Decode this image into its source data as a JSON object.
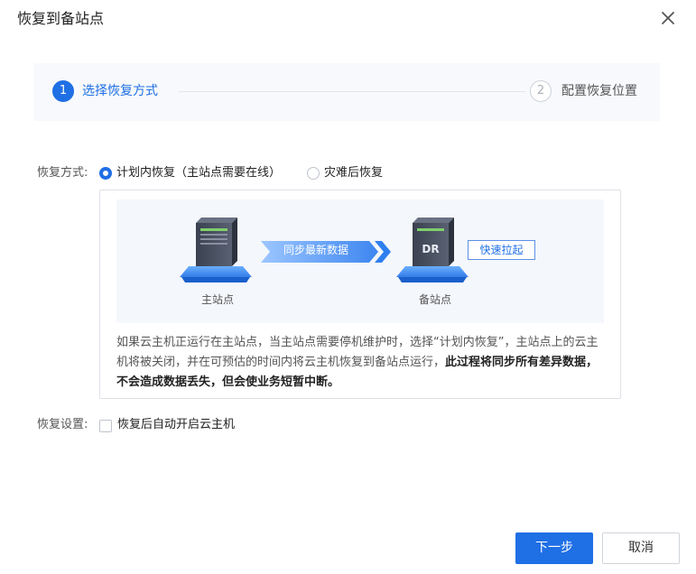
{
  "dialog": {
    "title": "恢复到备站点",
    "close_icon": "close-icon"
  },
  "steps": [
    {
      "number": "1",
      "label": "选择恢复方式",
      "state": "active"
    },
    {
      "number": "2",
      "label": "配置恢复位置",
      "state": "pending"
    }
  ],
  "recovery_mode": {
    "label": "恢复方式:",
    "options": [
      {
        "label": "计划内恢复（主站点需要在线）",
        "selected": true
      },
      {
        "label": "灾难后恢复",
        "selected": false
      }
    ],
    "illustration": {
      "primary_site": "主站点",
      "backup_site": "备站点",
      "sync_text": "同步最新数据",
      "backup_badge": "DR",
      "fast_tag": "快速拉起"
    },
    "description": {
      "normal": "如果云主机正运行在主站点，当主站点需要停机维护时，选择“计划内恢复”，主站点上的云主机将被关闭，并在可预估的时间内将云主机恢复到备站点运行，",
      "bold": "此过程将同步所有差异数据，不会造成数据丢失，但会使业务短暂中断。"
    }
  },
  "recovery_setting": {
    "label": "恢复设置:",
    "checkbox_label": "恢复后自动开启云主机",
    "checked": false
  },
  "footer": {
    "next_label": "下一步",
    "cancel_label": "取消"
  },
  "colors": {
    "primary": "#1f6fe5",
    "border": "#dde1e6",
    "step_bg": "#f7f9fc"
  }
}
